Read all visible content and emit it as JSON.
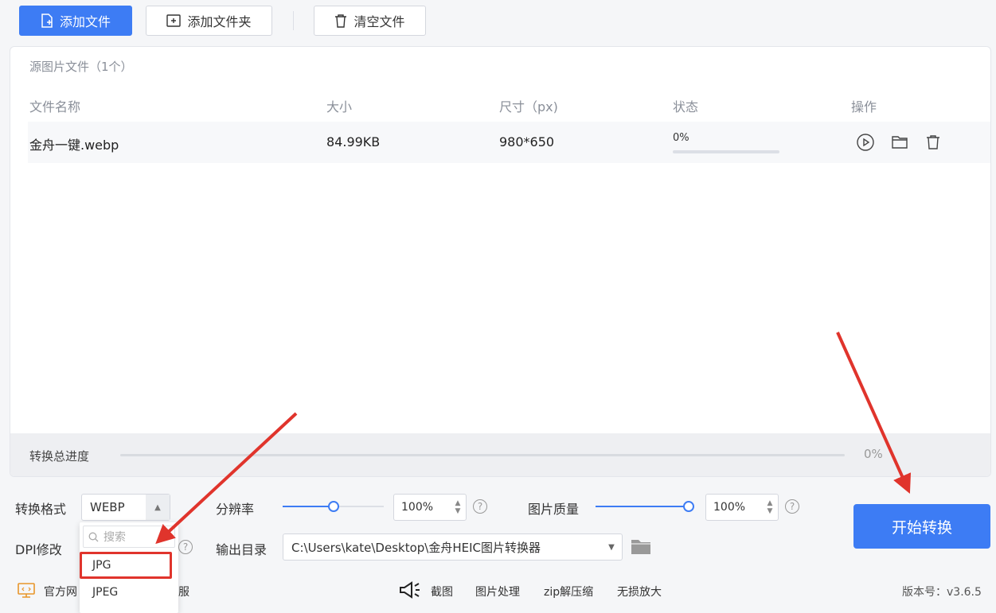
{
  "toolbar": {
    "add_file": "添加文件",
    "add_folder": "添加文件夹",
    "clear_files": "清空文件"
  },
  "file_panel": {
    "title": "源图片文件（1个）",
    "columns": [
      "文件名称",
      "大小",
      "尺寸（px)",
      "状态",
      "操作"
    ],
    "rows": [
      {
        "name": "金舟一键.webp",
        "size": "84.99KB",
        "dimensions": "980*650",
        "status": "0%",
        "progress": 0
      }
    ],
    "total_progress_label": "转换总进度",
    "total_progress_value": "0%",
    "total_progress": 0
  },
  "settings": {
    "format_label": "转换格式",
    "format_value": "WEBP",
    "dpi_label": "DPI修改",
    "resolution_label": "分辨率",
    "resolution_value": "100%",
    "resolution_level": 0.5,
    "quality_label": "图片质量",
    "quality_value": "100%",
    "quality_level": 1,
    "output_label": "输出目录",
    "output_value": "C:\\Users\\kate\\Desktop\\金舟HEIC图片转换器",
    "start_button": "开始转换"
  },
  "format_dropdown": {
    "search_placeholder": "搜索",
    "options": [
      "JPG",
      "JPEG"
    ],
    "highlighted": "JPG"
  },
  "footer": {
    "website": "官方网",
    "service_suffix": "服",
    "links": [
      "截图",
      "图片处理",
      "zip解压缩",
      "无损放大"
    ],
    "version": "版本号：v3.6.5"
  },
  "colors": {
    "primary": "#3d7cf4",
    "annotation": "#e0342c"
  }
}
